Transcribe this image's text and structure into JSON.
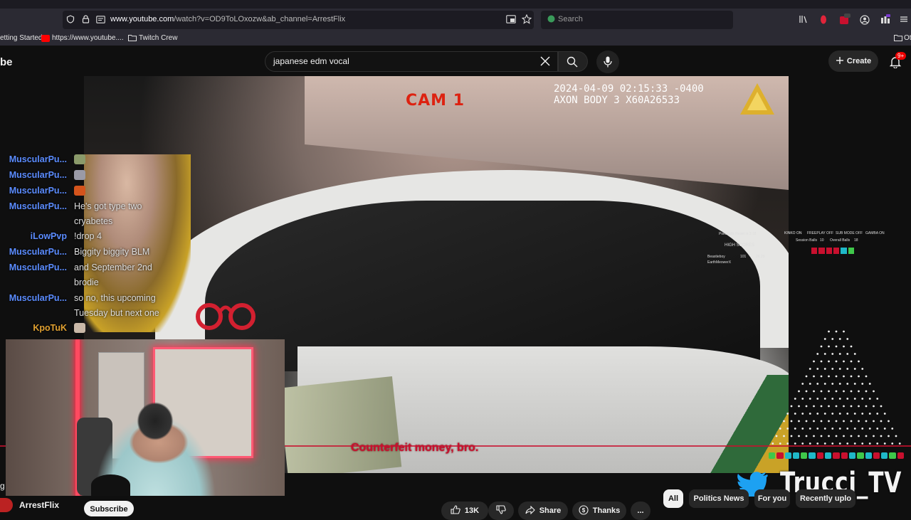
{
  "browser": {
    "tab_partial": "",
    "url_domain": "www.youtube.com",
    "url_path": "/watch?v=OD9ToLOxozw&ab_channel=ArrestFlix",
    "search_placeholder": "Search",
    "bookmarks": [
      "etting Started",
      "https://www.youtube....",
      "Twitch Crew"
    ],
    "bookmark_right": "Ot"
  },
  "youtube": {
    "logo_partial": "be",
    "search_query": "japanese edm vocal",
    "create_label": "Create",
    "notif_badge": "9+",
    "channel_name": "ArrestFlix",
    "subscribe_label": "Subscribe",
    "likes": "13K",
    "share_label": "Share",
    "thanks_label": "Thanks",
    "more_label": "...",
    "chips": [
      "All",
      "Politics News",
      "For you",
      "Recently uplo"
    ],
    "left_partial": "g"
  },
  "video": {
    "cam_label": "CAM 1",
    "timestamp_line1": "2024-04-09 02:15:33 -0400",
    "timestamp_line2": "AXON BODY 3 X60A26533",
    "subtitle": "Counterfeit money, bro."
  },
  "chat": [
    {
      "user": "MuscularPu...",
      "msg": "",
      "emote": "#8a9a6a"
    },
    {
      "user": "MuscularPu...",
      "msg": "",
      "emote": "#9a9aa6"
    },
    {
      "user": "MuscularPu...",
      "msg": "",
      "emote": "#d4541c"
    },
    {
      "user": "MuscularPu...",
      "msg": "He's got type two cryabetes"
    },
    {
      "user": "iLowPvp",
      "msg": "!drop 4"
    },
    {
      "user": "MuscularPu...",
      "msg": "Biggity biggity BLM"
    },
    {
      "user": "MuscularPu...",
      "msg": "and September 2nd brodie"
    },
    {
      "user": "MuscularPu...",
      "msg": "so no, this upcoming Tuesday but next one"
    },
    {
      "user": "KpoTuK",
      "msg": "",
      "emote": "#c9b8a8"
    }
  ],
  "stream_widgets": {
    "reset_text": "Pokeballs Reset in 3:18",
    "kinko": "KINKO ON",
    "freeplay": "FREEPLAY OFF",
    "sub_mode": "SUB MODE OFF",
    "gamba": "GAMBA ON",
    "session_balls": "Session Balls",
    "session_count": "10",
    "overall_balls": "Overall Balls",
    "overall_count": "18",
    "high_scores": "HIGH SCORES",
    "hs_rows": [
      "Beastieboy",
      "EarthMeowerX"
    ],
    "hs_vals": [
      "101",
      "26.20"
    ],
    "brand": "Trucci_TV"
  },
  "colors": {
    "chat_user": "#5b8cff",
    "cam_label": "#dd2211",
    "subtitle": "#c8102e",
    "accent_red": "#ff0000"
  },
  "icons": [
    "shield-icon",
    "lock-icon",
    "reader-icon",
    "pip-icon",
    "star-icon",
    "library-icon",
    "account-icon",
    "extensions-icon",
    "folder-icon",
    "close-icon",
    "search-icon",
    "mic-icon",
    "plus-icon",
    "bell-icon",
    "like-icon",
    "dislike-icon",
    "share-icon",
    "thanks-icon",
    "twitter-icon",
    "handcuffs-icon",
    "axon-logo-icon"
  ]
}
